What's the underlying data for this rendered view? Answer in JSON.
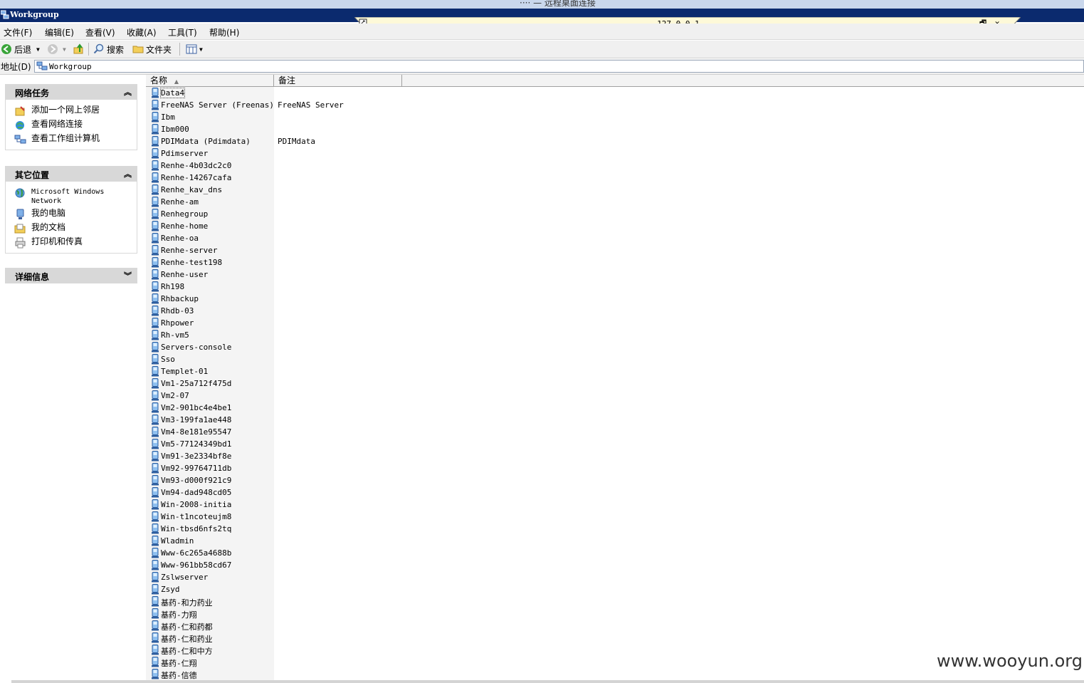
{
  "rdp": {
    "outer_title": "···· — 远程桌面连接",
    "address": "127.0.0.1",
    "min_label": "_",
    "restore_label": "🗗",
    "close_label": "✕"
  },
  "window": {
    "title": "Workgroup"
  },
  "menu": {
    "items": [
      "文件(F)",
      "编辑(E)",
      "查看(V)",
      "收藏(A)",
      "工具(T)",
      "帮助(H)"
    ]
  },
  "toolbar": {
    "back_label": "后退",
    "search_label": "搜索",
    "folders_label": "文件夹"
  },
  "address_bar": {
    "label": "地址(D)",
    "value": "Workgroup"
  },
  "task_pane": {
    "network_tasks": {
      "title": "网络任务",
      "items": [
        {
          "label": "添加一个网上邻居",
          "icon": "add-network-place-icon"
        },
        {
          "label": "查看网络连接",
          "icon": "network-connections-icon"
        },
        {
          "label": "查看工作组计算机",
          "icon": "workgroup-computers-icon"
        }
      ]
    },
    "other_places": {
      "title": "其它位置",
      "items": [
        {
          "label": "Microsoft Windows Network",
          "icon": "globe-network-icon"
        },
        {
          "label": "我的电脑",
          "icon": "my-computer-icon"
        },
        {
          "label": "我的文档",
          "icon": "my-documents-icon"
        },
        {
          "label": "打印机和传真",
          "icon": "printer-fax-icon"
        }
      ]
    },
    "details": {
      "title": "详细信息"
    }
  },
  "list": {
    "columns": {
      "name": "名称",
      "comment": "备注"
    },
    "rows": [
      {
        "name": "Data4",
        "comment": ""
      },
      {
        "name": "FreeNAS Server (Freenas)",
        "comment": "FreeNAS Server"
      },
      {
        "name": "Ibm",
        "comment": ""
      },
      {
        "name": "Ibm000",
        "comment": ""
      },
      {
        "name": "PDIMdata (Pdimdata)",
        "comment": "PDIMdata"
      },
      {
        "name": "Pdimserver",
        "comment": ""
      },
      {
        "name": "Renhe-4b03dc2c0",
        "comment": ""
      },
      {
        "name": "Renhe-14267cafa",
        "comment": ""
      },
      {
        "name": "Renhe_kav_dns",
        "comment": ""
      },
      {
        "name": "Renhe-am",
        "comment": ""
      },
      {
        "name": "Renhegroup",
        "comment": ""
      },
      {
        "name": "Renhe-home",
        "comment": ""
      },
      {
        "name": "Renhe-oa",
        "comment": ""
      },
      {
        "name": "Renhe-server",
        "comment": ""
      },
      {
        "name": "Renhe-test198",
        "comment": ""
      },
      {
        "name": "Renhe-user",
        "comment": ""
      },
      {
        "name": "Rh198",
        "comment": ""
      },
      {
        "name": "Rhbackup",
        "comment": ""
      },
      {
        "name": "Rhdb-03",
        "comment": ""
      },
      {
        "name": "Rhpower",
        "comment": ""
      },
      {
        "name": "Rh-vm5",
        "comment": ""
      },
      {
        "name": "Servers-console",
        "comment": ""
      },
      {
        "name": "Sso",
        "comment": ""
      },
      {
        "name": "Templet-01",
        "comment": ""
      },
      {
        "name": "Vm1-25a712f475d",
        "comment": ""
      },
      {
        "name": "Vm2-07",
        "comment": ""
      },
      {
        "name": "Vm2-901bc4e4be1",
        "comment": ""
      },
      {
        "name": "Vm3-199fa1ae448",
        "comment": ""
      },
      {
        "name": "Vm4-8e181e95547",
        "comment": ""
      },
      {
        "name": "Vm5-77124349bd1",
        "comment": ""
      },
      {
        "name": "Vm91-3e2334bf8e",
        "comment": ""
      },
      {
        "name": "Vm92-99764711db",
        "comment": ""
      },
      {
        "name": "Vm93-d000f921c9",
        "comment": ""
      },
      {
        "name": "Vm94-dad948cd05",
        "comment": ""
      },
      {
        "name": "Win-2008-initia",
        "comment": ""
      },
      {
        "name": "Win-t1ncoteujm8",
        "comment": ""
      },
      {
        "name": "Win-tbsd6nfs2tq",
        "comment": ""
      },
      {
        "name": "Wladmin",
        "comment": ""
      },
      {
        "name": "Www-6c265a4688b",
        "comment": ""
      },
      {
        "name": "Www-961bb58cd67",
        "comment": ""
      },
      {
        "name": "Zslwserver",
        "comment": ""
      },
      {
        "name": "Zsyd",
        "comment": ""
      },
      {
        "name": "基药-和力药业",
        "comment": ""
      },
      {
        "name": "基药-力翔",
        "comment": ""
      },
      {
        "name": "基药-仁和药都",
        "comment": ""
      },
      {
        "name": "基药-仁和药业",
        "comment": ""
      },
      {
        "name": "基药-仁和中方",
        "comment": ""
      },
      {
        "name": "基药-仁翔",
        "comment": ""
      },
      {
        "name": "基药-信德",
        "comment": ""
      }
    ]
  },
  "watermark": "www.wooyun.org",
  "colors": {
    "titlebar": "#0b2a6e",
    "connbar": "#fdf9d8",
    "panel_header": "#d8d8d8"
  }
}
